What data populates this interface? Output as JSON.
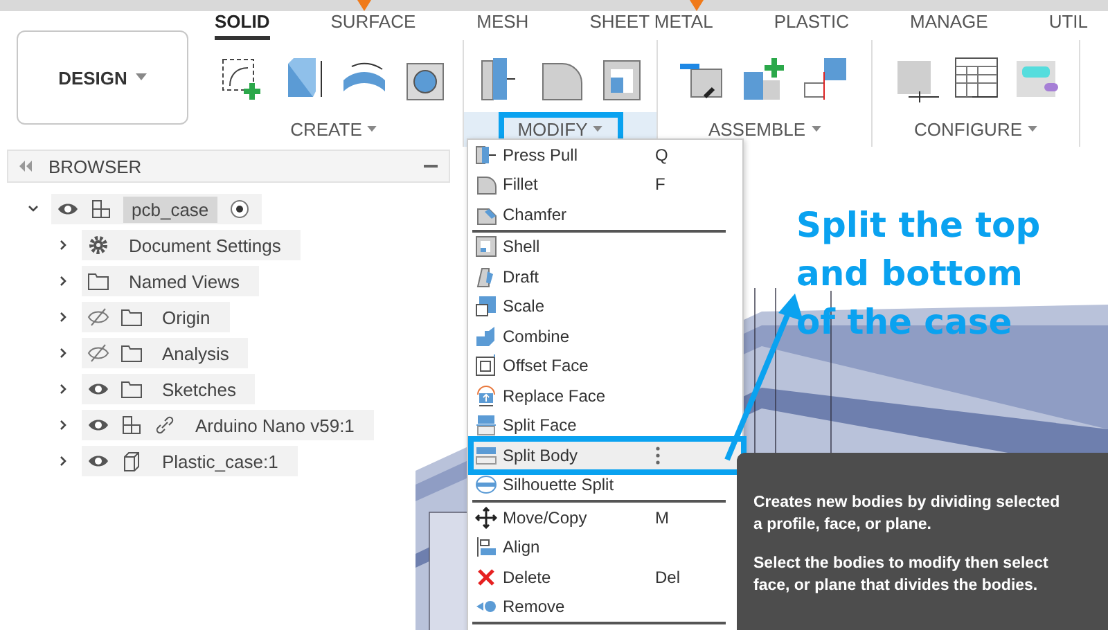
{
  "workspace": {
    "label": "DESIGN"
  },
  "ribbon_tabs": [
    {
      "label": "SOLID",
      "selected": true
    },
    {
      "label": "SURFACE",
      "selected": false
    },
    {
      "label": "MESH",
      "selected": false
    },
    {
      "label": "SHEET METAL",
      "selected": false
    },
    {
      "label": "PLASTIC",
      "selected": false
    },
    {
      "label": "MANAGE",
      "selected": false
    },
    {
      "label": "UTIL",
      "selected": false
    }
  ],
  "tool_groups": [
    {
      "label": "CREATE",
      "highlighted": false
    },
    {
      "label": "MODIFY",
      "highlighted": true
    },
    {
      "label": "ASSEMBLE",
      "highlighted": false
    },
    {
      "label": "CONFIGURE",
      "highlighted": false
    }
  ],
  "browser": {
    "title": "BROWSER",
    "tree": [
      {
        "label": "pcb_case",
        "kind": "component",
        "visible": true,
        "expanded": true,
        "active": true,
        "children": [
          {
            "label": "Document Settings",
            "kind": "settings",
            "expanded": false
          },
          {
            "label": "Named Views",
            "kind": "folder",
            "expanded": false
          },
          {
            "label": "Origin",
            "kind": "folder",
            "visible": false,
            "expanded": false
          },
          {
            "label": "Analysis",
            "kind": "folder",
            "visible": false,
            "expanded": false
          },
          {
            "label": "Sketches",
            "kind": "folder",
            "visible": true,
            "expanded": false
          },
          {
            "label": "Arduino Nano v59:1",
            "kind": "component",
            "visible": true,
            "linked": true,
            "expanded": false
          },
          {
            "label": "Plastic_case:1",
            "kind": "body",
            "visible": true,
            "expanded": false
          }
        ]
      }
    ]
  },
  "menu": {
    "sections": [
      [
        {
          "label": "Press Pull",
          "shortcut": "Q",
          "selected": false
        },
        {
          "label": "Fillet",
          "shortcut": "F",
          "selected": false
        },
        {
          "label": "Chamfer",
          "selected": false
        }
      ],
      [
        {
          "label": "Shell",
          "selected": false
        },
        {
          "label": "Draft",
          "selected": false
        },
        {
          "label": "Scale",
          "selected": false
        },
        {
          "label": "Combine",
          "selected": false
        },
        {
          "label": "Offset Face",
          "selected": false
        },
        {
          "label": "Replace Face",
          "selected": false
        },
        {
          "label": "Split Face",
          "selected": false
        },
        {
          "label": "Split Body",
          "selected": true
        },
        {
          "label": "Silhouette Split",
          "selected": false
        }
      ],
      [
        {
          "label": "Move/Copy",
          "shortcut": "M",
          "selected": false
        },
        {
          "label": "Align",
          "selected": false
        },
        {
          "label": "Delete",
          "shortcut": "Del",
          "selected": false
        },
        {
          "label": "Remove",
          "selected": false
        }
      ]
    ]
  },
  "annotation": {
    "text": "Split the top and bottom of the case"
  },
  "tooltip": {
    "paragraphs": [
      [
        "Creates new bodies by dividing selected",
        "a profile, face, or plane."
      ],
      [
        "Select the bodies to modify then select",
        "face, or plane that divides the bodies."
      ]
    ]
  }
}
